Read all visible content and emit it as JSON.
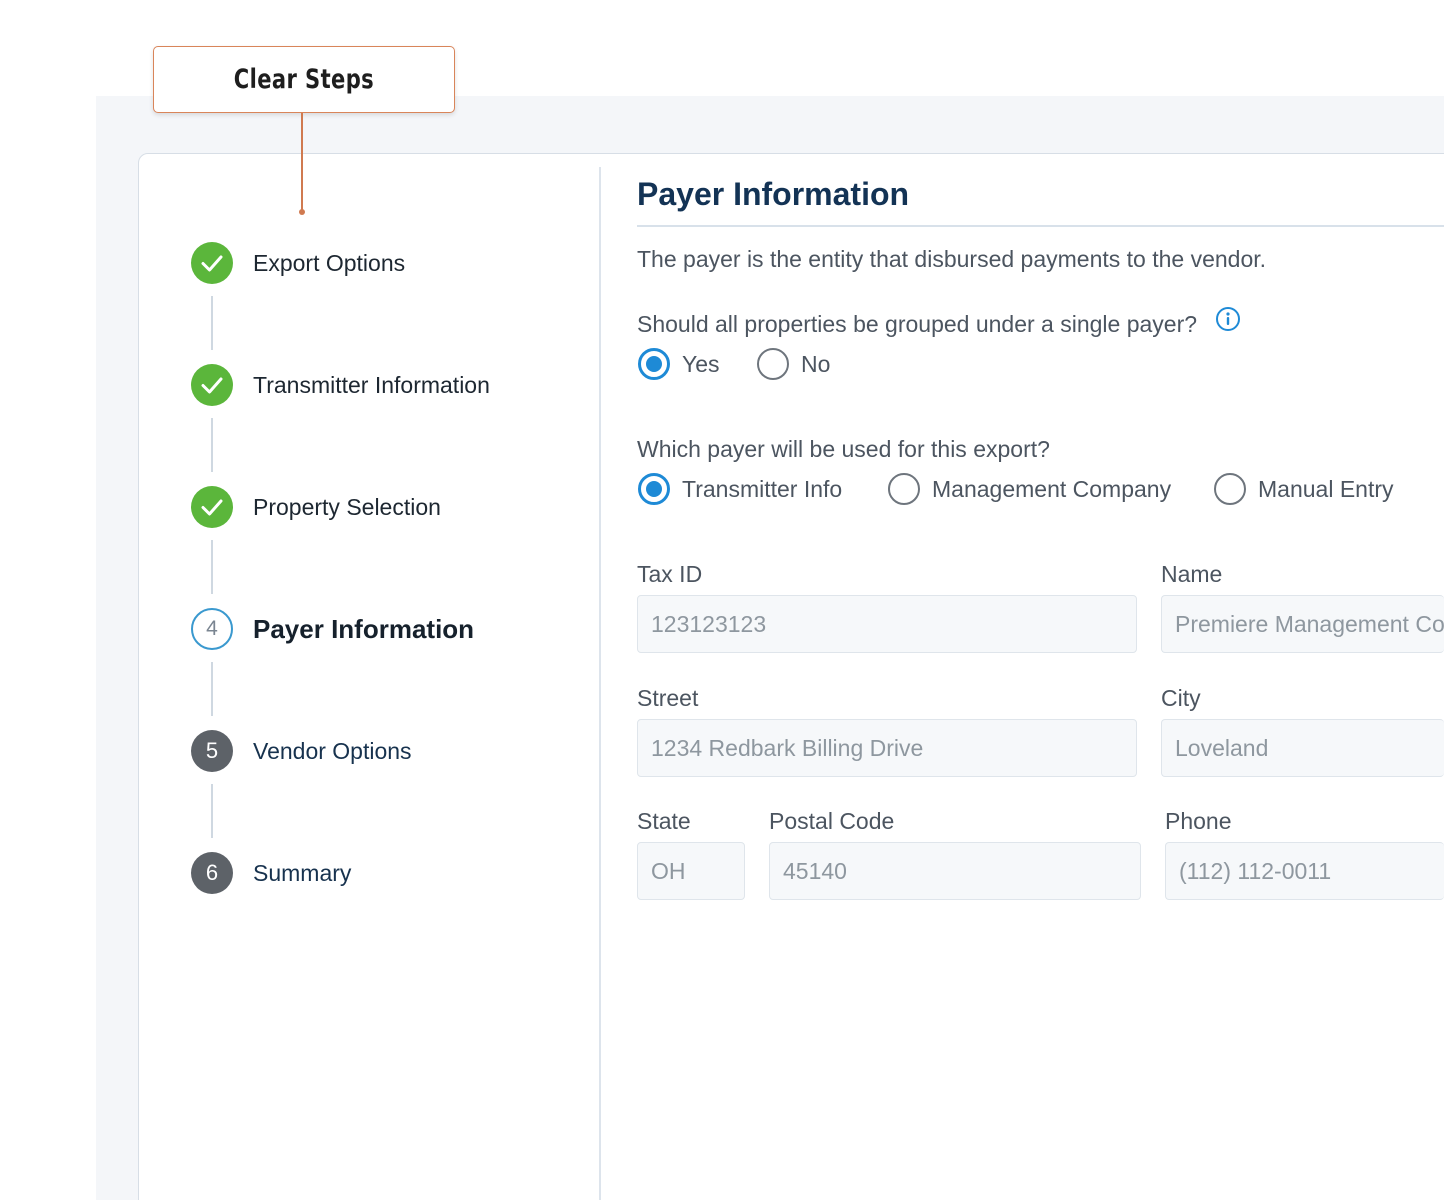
{
  "callout": {
    "text": "Clear Steps",
    "accent": "#d07a50"
  },
  "steps": [
    {
      "label": "Export Options",
      "status": "done",
      "icon": "check-icon"
    },
    {
      "label": "Transmitter Information",
      "status": "done",
      "icon": "check-icon"
    },
    {
      "label": "Property Selection",
      "status": "done",
      "icon": "check-icon"
    },
    {
      "label": "Payer Information",
      "status": "current",
      "number": "4"
    },
    {
      "label": "Vendor Options",
      "status": "todo",
      "number": "5"
    },
    {
      "label": "Summary",
      "status": "todo",
      "number": "6"
    }
  ],
  "form": {
    "title": "Payer Information",
    "description": "The payer is the entity that disbursed payments to the vendor.",
    "group_question": "Should all properties be grouped under a single payer?",
    "group_options": [
      {
        "label": "Yes",
        "selected": true
      },
      {
        "label": "No",
        "selected": false
      }
    ],
    "payer_question": "Which payer will be used for this export?",
    "payer_options": [
      {
        "label": "Transmitter Info",
        "selected": true
      },
      {
        "label": "Management Company",
        "selected": false
      },
      {
        "label": "Manual Entry",
        "selected": false
      }
    ],
    "fields": {
      "tax_id": {
        "label": "Tax ID",
        "value": "123123123"
      },
      "name": {
        "label": "Name",
        "value": "Premiere Management Co"
      },
      "street": {
        "label": "Street",
        "value": "1234 Redbark Billing Drive"
      },
      "city": {
        "label": "City",
        "value": "Loveland"
      },
      "state": {
        "label": "State",
        "value": "OH"
      },
      "postal_code": {
        "label": "Postal Code",
        "value": "45140"
      },
      "phone": {
        "label": "Phone",
        "value": "(112) 112-0011"
      }
    }
  },
  "colors": {
    "done": "#5bb63b",
    "current": "#3a99cf",
    "todo": "#5d6268",
    "radio_selected": "#1e8ad6",
    "title": "#133355"
  }
}
